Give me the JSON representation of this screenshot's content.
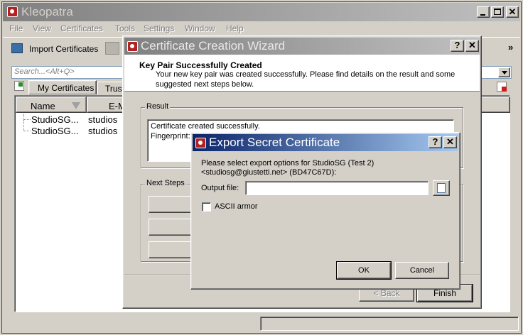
{
  "main_window": {
    "title": "Kleopatra",
    "menu": [
      "File",
      "View",
      "Certificates",
      "Tools",
      "Settings",
      "Window",
      "Help"
    ],
    "toolbar": {
      "import_label": "Import Certificates",
      "overflow": "»"
    },
    "search": {
      "placeholder": "Search...<Alt+Q>"
    },
    "tabs": [
      "My Certificates",
      "Trust"
    ],
    "columns": [
      "Name",
      "E-M"
    ],
    "rows": [
      {
        "name": "StudioSG...",
        "email": "studios"
      },
      {
        "name": "StudioSG...",
        "email": "studios"
      }
    ]
  },
  "wizard": {
    "title": "Certificate Creation Wizard",
    "heading": "Key Pair Successfully Created",
    "subtitle_line1": "Your new key pair was created successfully. Please find details on the result and some",
    "subtitle_line2": "suggested next steps below.",
    "result_group": "Result",
    "result_line1": "Certificate created successfully.",
    "result_line2": "Fingerprint:",
    "next_steps_group": "Next Steps",
    "back_label": "< Back",
    "finish_label": "Finish",
    "help_glyph": "?",
    "close_glyph": "✕"
  },
  "export_dialog": {
    "title": "Export Secret Certificate",
    "description_line1": "Please select export options for StudioSG (Test 2)",
    "description_line2": "<studiosg@giustetti.net> (BD47C67D):",
    "output_label": "Output file:",
    "output_value": "",
    "ascii_label": "ASCII armor",
    "ascii_checked": false,
    "ok_label": "OK",
    "cancel_label": "Cancel",
    "help_glyph": "?",
    "close_glyph": "✕"
  },
  "colors": {
    "active_title_start": "#0a246a",
    "active_title_end": "#a6caf0",
    "inactive_title_start": "#808080",
    "inactive_title_end": "#c0c0c0",
    "face": "#d4d0c8"
  }
}
